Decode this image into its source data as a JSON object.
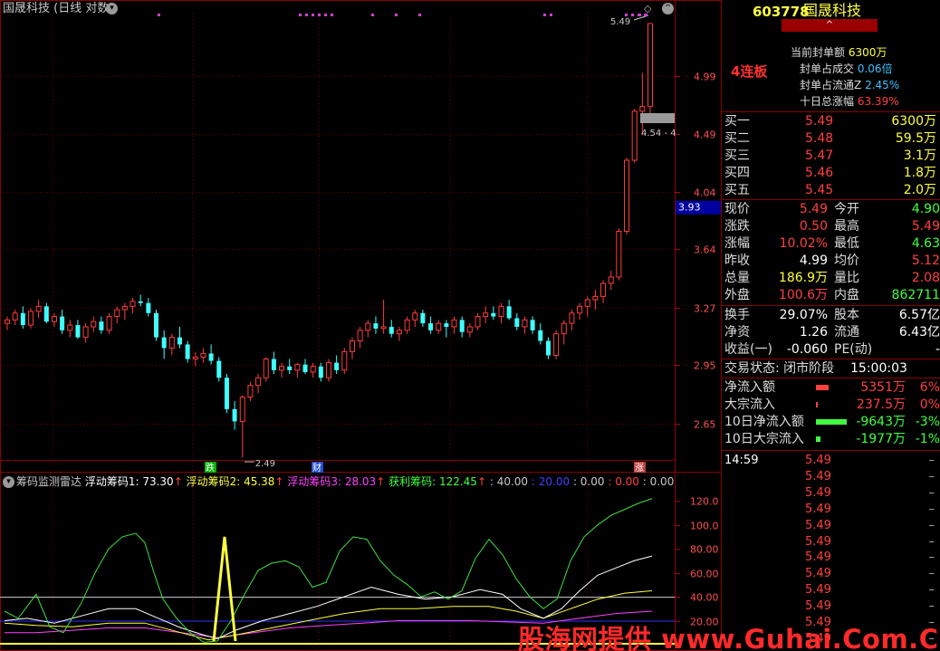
{
  "chart": {
    "title": "国晟科技 (日线 对数)",
    "price_axis": [
      "4.99",
      "4.49",
      "4.04",
      "3.64",
      "3.27",
      "2.95",
      "2.65"
    ],
    "current_tag": "3.93",
    "annotations": {
      "high": "5.49",
      "low": "2.49",
      "range": "4.54 - 4"
    },
    "markers": [
      {
        "text": "跌",
        "color": "#00b000",
        "index": 39
      },
      {
        "text": "财",
        "color": "#2050d0",
        "index": 59
      },
      {
        "text": "涨",
        "color": "#c04040",
        "index": 118
      }
    ]
  },
  "indicator": {
    "name": "筹码监测雷达",
    "legend": [
      "浮动筹码1: 73.30",
      "浮动筹码2: 45.38",
      "浮动筹码3: 28.03",
      "获利筹码: 122.45",
      ": 40.00",
      ": 20.00",
      ": 0.00",
      ": 0.00",
      ": 0.00"
    ],
    "axis": [
      "120.0",
      "100.0",
      "80.00",
      "60.00",
      "40.00",
      "20.00"
    ]
  },
  "quote": {
    "code": "603778",
    "name": "国晟科技",
    "streak": "4连板"
  },
  "seal": [
    {
      "label": "当前封单额",
      "value": "6300万"
    },
    {
      "label": "封单占成交",
      "value": "0.06倍"
    },
    {
      "label": "封单占流通Z",
      "value": "2.45%"
    },
    {
      "label": "十日总涨幅",
      "value": "63.39%"
    }
  ],
  "order_book": [
    {
      "label": "买一",
      "price": "5.49",
      "vol": "6300万"
    },
    {
      "label": "买二",
      "price": "5.48",
      "vol": "59.5万"
    },
    {
      "label": "买三",
      "price": "5.47",
      "vol": "3.1万"
    },
    {
      "label": "买四",
      "price": "5.46",
      "vol": "1.8万"
    },
    {
      "label": "买五",
      "price": "5.45",
      "vol": "2.0万"
    }
  ],
  "stats": [
    {
      "l1": "现价",
      "v1": "5.49",
      "c1": "#ff4040",
      "l2": "今开",
      "v2": "4.90",
      "c2": "#40ff40"
    },
    {
      "l1": "涨跌",
      "v1": "0.50",
      "c1": "#ff4040",
      "l2": "最高",
      "v2": "5.49",
      "c2": "#ff4040"
    },
    {
      "l1": "涨幅",
      "v1": "10.02%",
      "c1": "#ff4040",
      "l2": "最低",
      "v2": "4.63",
      "c2": "#40ff40"
    },
    {
      "l1": "昨收",
      "v1": "4.99",
      "c1": "#ffffff",
      "l2": "均价",
      "v2": "5.12",
      "c2": "#ff4040"
    },
    {
      "l1": "总量",
      "v1": "186.9万",
      "c1": "#ffff40",
      "l2": "量比",
      "v2": "2.08",
      "c2": "#ff4040"
    },
    {
      "l1": "外盘",
      "v1": "100.6万",
      "c1": "#ff4040",
      "l2": "内盘",
      "v2": "862711",
      "c2": "#40ff40"
    }
  ],
  "stats2": [
    {
      "l1": "换手",
      "v1": "29.07%",
      "c1": "#ffffff",
      "l2": "股本",
      "v2": "6.57亿",
      "c2": "#ffffff"
    },
    {
      "l1": "净资",
      "v1": "1.26",
      "c1": "#ffffff",
      "l2": "流通",
      "v2": "6.43亿",
      "c2": "#ffffff"
    },
    {
      "l1": "收益(一)",
      "v1": "-0.060",
      "c1": "#ffffff",
      "l2": "PE(动)",
      "v2": "-",
      "c2": "#ffffff"
    }
  ],
  "trade_status": {
    "label": "交易状态: 闭市阶段",
    "time": "15:00:03"
  },
  "flows": [
    {
      "label": "净流入额",
      "value": "5351万",
      "pct": "6%",
      "color": "#ff4040",
      "level": 0.4
    },
    {
      "label": "大宗流入",
      "value": "237.5万",
      "pct": "0%",
      "color": "#ff4040",
      "level": 0.05
    },
    {
      "label": "10日净流入额",
      "value": "-9643万",
      "pct": "-3%",
      "color": "#40ff40",
      "level": 1.0
    },
    {
      "label": "10日大宗流入",
      "value": "-1977万",
      "pct": "-1%",
      "color": "#40ff40",
      "level": 0.15
    }
  ],
  "ticks": [
    {
      "time": "14:59",
      "price": "5.49"
    },
    {
      "time": "",
      "price": "5.49"
    },
    {
      "time": "",
      "price": "5.49"
    },
    {
      "time": "",
      "price": "5.49"
    },
    {
      "time": "",
      "price": "5.49"
    },
    {
      "time": "",
      "price": "5.49"
    },
    {
      "time": "",
      "price": "5.49"
    },
    {
      "time": "",
      "price": "5.49"
    },
    {
      "time": "",
      "price": "5.49"
    },
    {
      "time": "",
      "price": "5.49"
    },
    {
      "time": "",
      "price": "5.49"
    },
    {
      "time": "",
      "price": "5.49"
    }
  ],
  "watermark": "股海网提供 www.Guhai.Com.CN",
  "chart_data": {
    "type": "candlestick",
    "log_scale": true,
    "ylim": [
      2.5,
      5.6
    ],
    "candles": [
      [
        3.18,
        3.22,
        3.14,
        3.2
      ],
      [
        3.2,
        3.26,
        3.17,
        3.24
      ],
      [
        3.24,
        3.28,
        3.15,
        3.17
      ],
      [
        3.17,
        3.27,
        3.15,
        3.25
      ],
      [
        3.25,
        3.32,
        3.21,
        3.28
      ],
      [
        3.28,
        3.3,
        3.18,
        3.19
      ],
      [
        3.19,
        3.24,
        3.16,
        3.22
      ],
      [
        3.22,
        3.26,
        3.12,
        3.14
      ],
      [
        3.14,
        3.2,
        3.1,
        3.17
      ],
      [
        3.17,
        3.2,
        3.09,
        3.1
      ],
      [
        3.1,
        3.18,
        3.07,
        3.16
      ],
      [
        3.16,
        3.22,
        3.13,
        3.19
      ],
      [
        3.19,
        3.22,
        3.12,
        3.14
      ],
      [
        3.14,
        3.24,
        3.12,
        3.22
      ],
      [
        3.22,
        3.28,
        3.18,
        3.26
      ],
      [
        3.26,
        3.3,
        3.2,
        3.28
      ],
      [
        3.28,
        3.33,
        3.24,
        3.31
      ],
      [
        3.31,
        3.35,
        3.28,
        3.3
      ],
      [
        3.3,
        3.33,
        3.22,
        3.24
      ],
      [
        3.24,
        3.26,
        3.08,
        3.1
      ],
      [
        3.1,
        3.14,
        2.98,
        3.04
      ],
      [
        3.04,
        3.12,
        3.0,
        3.1
      ],
      [
        3.1,
        3.16,
        3.04,
        3.06
      ],
      [
        3.06,
        3.08,
        2.96,
        2.98
      ],
      [
        2.98,
        3.02,
        2.94,
        2.99
      ],
      [
        2.99,
        3.04,
        2.96,
        3.01
      ],
      [
        3.01,
        3.06,
        2.95,
        2.97
      ],
      [
        2.97,
        2.99,
        2.86,
        2.88
      ],
      [
        2.88,
        2.9,
        2.7,
        2.72
      ],
      [
        2.72,
        2.76,
        2.62,
        2.66
      ],
      [
        2.66,
        2.79,
        2.49,
        2.78
      ],
      [
        2.78,
        2.86,
        2.76,
        2.84
      ],
      [
        2.84,
        2.9,
        2.8,
        2.88
      ],
      [
        2.88,
        2.99,
        2.86,
        2.98
      ],
      [
        2.98,
        3.02,
        2.9,
        2.92
      ],
      [
        2.92,
        2.96,
        2.88,
        2.94
      ],
      [
        2.94,
        2.98,
        2.9,
        2.92
      ],
      [
        2.92,
        2.96,
        2.88,
        2.95
      ],
      [
        2.95,
        2.98,
        2.9,
        2.91
      ],
      [
        2.91,
        2.96,
        2.88,
        2.94
      ],
      [
        2.94,
        2.96,
        2.86,
        2.88
      ],
      [
        2.88,
        2.98,
        2.86,
        2.96
      ],
      [
        2.96,
        3.0,
        2.9,
        2.92
      ],
      [
        2.92,
        3.04,
        2.9,
        3.02
      ],
      [
        3.02,
        3.1,
        2.98,
        3.08
      ],
      [
        3.08,
        3.16,
        3.04,
        3.14
      ],
      [
        3.14,
        3.2,
        3.1,
        3.18
      ],
      [
        3.18,
        3.22,
        3.12,
        3.15
      ],
      [
        3.15,
        3.32,
        3.12,
        3.16
      ],
      [
        3.16,
        3.2,
        3.1,
        3.12
      ],
      [
        3.12,
        3.16,
        3.08,
        3.14
      ],
      [
        3.14,
        3.22,
        3.12,
        3.2
      ],
      [
        3.2,
        3.26,
        3.16,
        3.24
      ],
      [
        3.24,
        3.26,
        3.16,
        3.18
      ],
      [
        3.18,
        3.22,
        3.12,
        3.14
      ],
      [
        3.14,
        3.2,
        3.12,
        3.18
      ],
      [
        3.18,
        3.2,
        3.1,
        3.16
      ],
      [
        3.16,
        3.22,
        3.12,
        3.2
      ],
      [
        3.2,
        3.22,
        3.1,
        3.13
      ],
      [
        3.13,
        3.18,
        3.1,
        3.16
      ],
      [
        3.16,
        3.24,
        3.14,
        3.22
      ],
      [
        3.22,
        3.28,
        3.18,
        3.24
      ],
      [
        3.24,
        3.28,
        3.2,
        3.22
      ],
      [
        3.22,
        3.3,
        3.18,
        3.28
      ],
      [
        3.28,
        3.32,
        3.2,
        3.21
      ],
      [
        3.21,
        3.24,
        3.14,
        3.16
      ],
      [
        3.16,
        3.22,
        3.12,
        3.2
      ],
      [
        3.2,
        3.22,
        3.12,
        3.14
      ],
      [
        3.14,
        3.18,
        3.06,
        3.08
      ],
      [
        3.08,
        3.1,
        2.98,
        3.0
      ],
      [
        3.0,
        3.14,
        2.98,
        3.12
      ],
      [
        3.12,
        3.2,
        3.06,
        3.18
      ],
      [
        3.18,
        3.26,
        3.14,
        3.24
      ],
      [
        3.24,
        3.3,
        3.2,
        3.28
      ],
      [
        3.28,
        3.34,
        3.22,
        3.32
      ],
      [
        3.32,
        3.38,
        3.26,
        3.34
      ],
      [
        3.34,
        3.44,
        3.3,
        3.42
      ],
      [
        3.42,
        3.5,
        3.38,
        3.46
      ],
      [
        3.46,
        3.78,
        3.44,
        3.76
      ],
      [
        3.76,
        4.3,
        3.74,
        4.28
      ],
      [
        4.28,
        4.7,
        4.26,
        4.68
      ],
      [
        4.68,
        5.02,
        4.48,
        4.72
      ],
      [
        4.72,
        5.49,
        4.63,
        5.49
      ]
    ]
  }
}
